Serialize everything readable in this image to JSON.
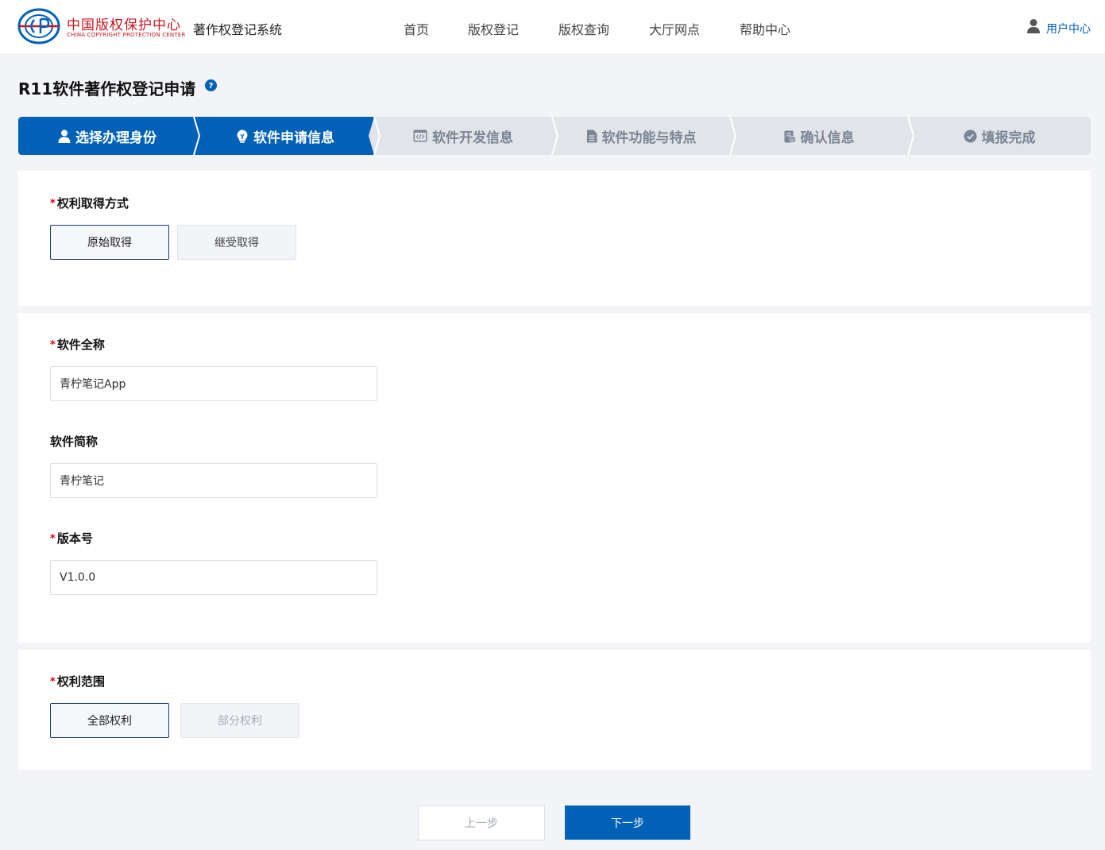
{
  "header": {
    "logo_cn": "中国版权保护中心",
    "logo_en": "CHINA COPYRIGHT PROTECTION CENTER",
    "system_name": "著作权登记系统",
    "nav": [
      "首页",
      "版权登记",
      "版权查询",
      "大厅网点",
      "帮助中心"
    ],
    "user_center": "用户中心"
  },
  "page": {
    "title": "R11软件著作权登记申请"
  },
  "steps": [
    {
      "label": "选择办理身份",
      "icon": "user-icon",
      "state": "done"
    },
    {
      "label": "软件申请信息",
      "icon": "lightbulb-icon",
      "state": "current"
    },
    {
      "label": "软件开发信息",
      "icon": "code-window-icon",
      "state": "todo"
    },
    {
      "label": "软件功能与特点",
      "icon": "document-icon",
      "state": "todo"
    },
    {
      "label": "确认信息",
      "icon": "clipboard-check-icon",
      "state": "todo"
    },
    {
      "label": "填报完成",
      "icon": "check-circle-icon",
      "state": "todo"
    }
  ],
  "form": {
    "acquisition": {
      "label": "权利取得方式",
      "required": "*",
      "options": [
        "原始取得",
        "继受取得"
      ],
      "selected": "原始取得"
    },
    "full_name": {
      "label": "软件全称",
      "required": "*",
      "value": "青柠笔记App"
    },
    "short_name": {
      "label": "软件简称",
      "value": "青柠笔记"
    },
    "version": {
      "label": "版本号",
      "required": "*",
      "value": "V1.0.0"
    },
    "scope": {
      "label": "权利范围",
      "required": "*",
      "options": [
        "全部权利",
        "部分权利"
      ],
      "selected": "全部权利"
    }
  },
  "footer": {
    "prev_label": "上一步",
    "next_label": "下一步"
  },
  "colors": {
    "primary": "#0061b7",
    "step_inactive_bg": "#e1e5ea",
    "logo_red": "#c8161e",
    "required": "#d9001b"
  }
}
